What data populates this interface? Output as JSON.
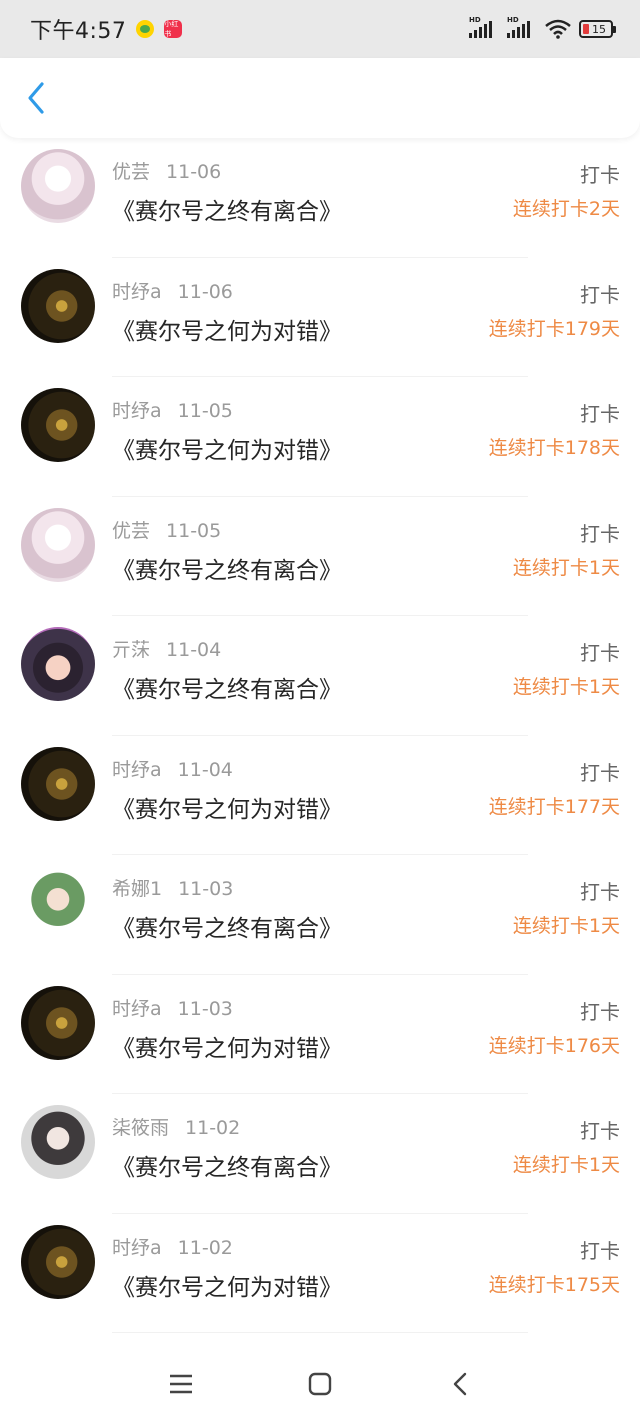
{
  "status_bar": {
    "time": "下午4:57",
    "red_app_label": "小红书",
    "battery": "15",
    "signal_label": "HD"
  },
  "header": {
    "back_icon": "chevron-left-icon",
    "accent_color": "#2f9be8"
  },
  "streak_color": "#ee8a45",
  "records": [
    {
      "name": "优芸",
      "date": "11-06",
      "title": "《赛尔号之终有离合》",
      "action": "打卡",
      "streak": "连续打卡2天",
      "avatar": "dress"
    },
    {
      "name": "时纾a",
      "date": "11-06",
      "title": "《赛尔号之何为对错》",
      "action": "打卡",
      "streak": "连续打卡179天",
      "avatar": "dark"
    },
    {
      "name": "时纾a",
      "date": "11-05",
      "title": "《赛尔号之何为对错》",
      "action": "打卡",
      "streak": "连续打卡178天",
      "avatar": "dark"
    },
    {
      "name": "优芸",
      "date": "11-05",
      "title": "《赛尔号之终有离合》",
      "action": "打卡",
      "streak": "连续打卡1天",
      "avatar": "dress"
    },
    {
      "name": "亓莯",
      "date": "11-04",
      "title": "《赛尔号之终有离合》",
      "action": "打卡",
      "streak": "连续打卡1天",
      "avatar": "girl"
    },
    {
      "name": "时纾a",
      "date": "11-04",
      "title": "《赛尔号之何为对错》",
      "action": "打卡",
      "streak": "连续打卡177天",
      "avatar": "dark"
    },
    {
      "name": "希娜1",
      "date": "11-03",
      "title": "《赛尔号之终有离合》",
      "action": "打卡",
      "streak": "连续打卡1天",
      "avatar": "elf"
    },
    {
      "name": "时纾a",
      "date": "11-03",
      "title": "《赛尔号之何为对错》",
      "action": "打卡",
      "streak": "连续打卡176天",
      "avatar": "dark"
    },
    {
      "name": "柒筱雨",
      "date": "11-02",
      "title": "《赛尔号之终有离合》",
      "action": "打卡",
      "streak": "连续打卡1天",
      "avatar": "gray"
    },
    {
      "name": "时纾a",
      "date": "11-02",
      "title": "《赛尔号之何为对错》",
      "action": "打卡",
      "streak": "连续打卡175天",
      "avatar": "dark"
    }
  ],
  "nav_bar": {
    "items": [
      "menu-icon",
      "home-icon",
      "back-icon"
    ]
  }
}
